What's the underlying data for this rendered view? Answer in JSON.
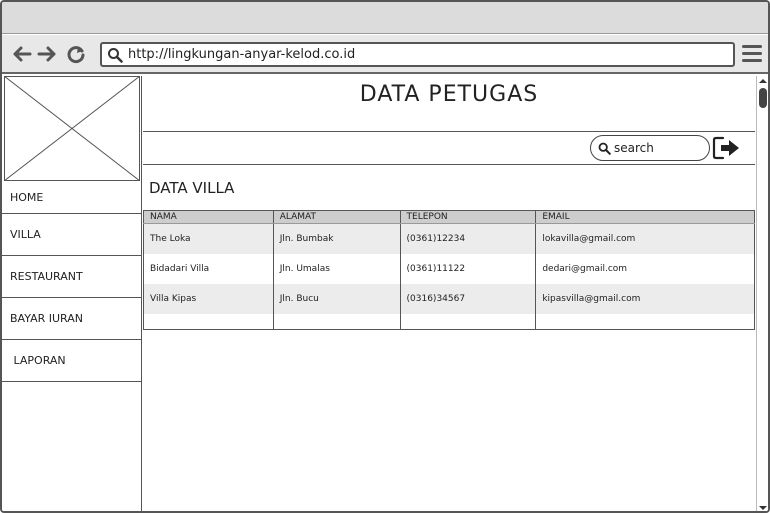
{
  "browser": {
    "url": "http://lingkungan-anyar-kelod.co.id"
  },
  "sidebar": {
    "items": [
      {
        "label": "HOME"
      },
      {
        "label": "VILLA"
      },
      {
        "label": "RESTAURANT"
      },
      {
        "label": "BAYAR IURAN"
      },
      {
        "label": " LAPORAN"
      }
    ]
  },
  "header": {
    "title": "DATA PETUGAS"
  },
  "search": {
    "placeholder": "search"
  },
  "main": {
    "section_title": "DATA VILLA",
    "table": {
      "columns": [
        "NAMA",
        "ALAMAT",
        "TELEPON",
        "EMAIL"
      ],
      "rows": [
        [
          "The Loka",
          "Jln. Bumbak",
          "(0361)12234",
          "lokavilla@gmail.com"
        ],
        [
          "Bidadari Villa",
          "Jln. Umalas",
          "(0361)11122",
          "dedari@gmail.com"
        ],
        [
          "Villa Kipas",
          "Jln. Bucu",
          "(0316)34567",
          "kipasvilla@gmail.com"
        ]
      ]
    }
  },
  "icons": {
    "back": "arrow-left-icon",
    "forward": "arrow-right-icon",
    "reload": "reload-icon",
    "url_search": "search-icon",
    "menu": "hamburger-menu-icon",
    "search": "search-icon",
    "logout": "logout-icon"
  }
}
